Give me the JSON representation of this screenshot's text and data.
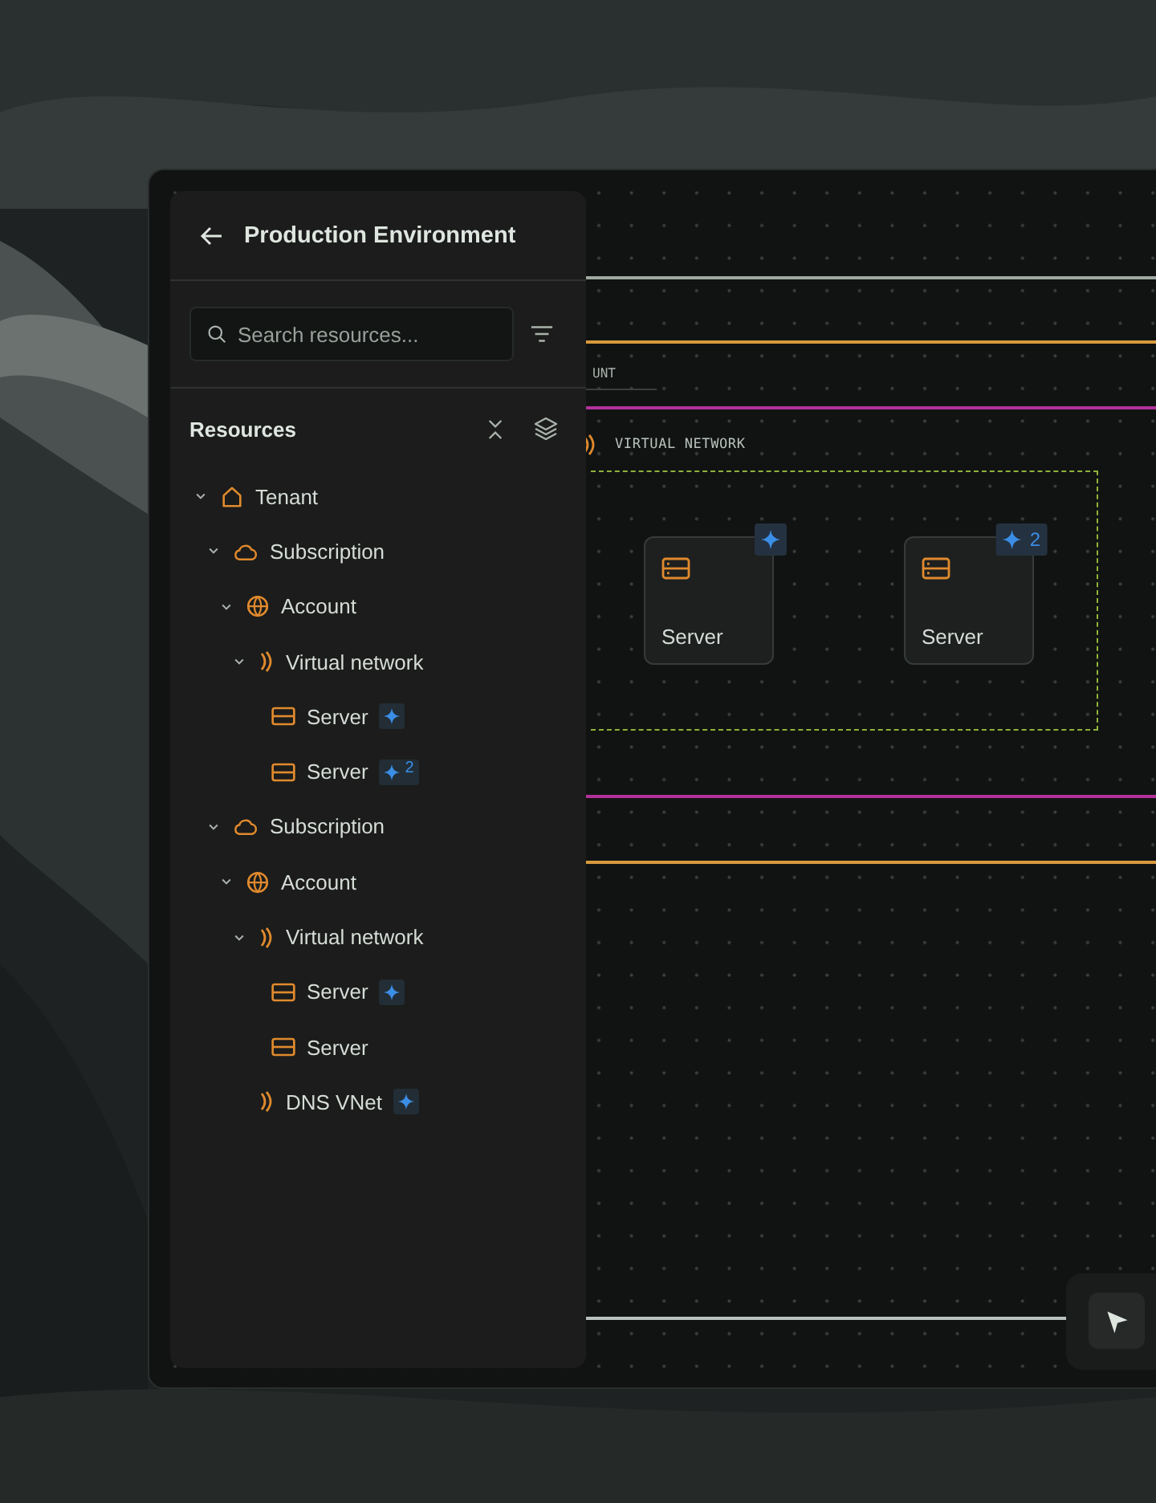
{
  "sidebar": {
    "title": "Production Environment",
    "search": {
      "placeholder": "Search resources..."
    },
    "section_title": "Resources",
    "tree": [
      {
        "label": "Tenant",
        "kind": "tenant",
        "expanded": true,
        "children": [
          {
            "label": "Subscription",
            "kind": "subscription",
            "expanded": true,
            "children": [
              {
                "label": "Account",
                "kind": "account",
                "expanded": true,
                "children": [
                  {
                    "label": "Virtual network",
                    "kind": "network",
                    "expanded": true,
                    "children": [
                      {
                        "label": "Server",
                        "kind": "server",
                        "ai_badge": true
                      },
                      {
                        "label": "Server",
                        "kind": "server",
                        "ai_badge": true,
                        "badge_count": "2"
                      }
                    ]
                  }
                ]
              }
            ]
          },
          {
            "label": "Subscription",
            "kind": "subscription",
            "expanded": true,
            "children": [
              {
                "label": "Account",
                "kind": "account",
                "expanded": true,
                "children": [
                  {
                    "label": "Virtual network",
                    "kind": "network",
                    "expanded": true,
                    "children": [
                      {
                        "label": "Server",
                        "kind": "server",
                        "ai_badge": true
                      },
                      {
                        "label": "Server",
                        "kind": "server"
                      }
                    ]
                  },
                  {
                    "label": "DNS VNet",
                    "kind": "network",
                    "ai_badge": true
                  }
                ]
              }
            ]
          }
        ]
      }
    ]
  },
  "canvas": {
    "boundaries": [
      {
        "color": "#9ea8a2"
      },
      {
        "color": "#d89a3c"
      },
      {
        "color": "#b2329a"
      },
      {
        "color": "#b2329a"
      },
      {
        "color": "#d89a3c"
      },
      {
        "color": "#b9c2bc"
      }
    ],
    "account_label": "UNT",
    "network_label": "VIRTUAL NETWORK",
    "nodes": [
      {
        "label": "Server",
        "ai_badge": true
      },
      {
        "label": "Server",
        "ai_badge": true,
        "badge_count": "2"
      }
    ]
  }
}
